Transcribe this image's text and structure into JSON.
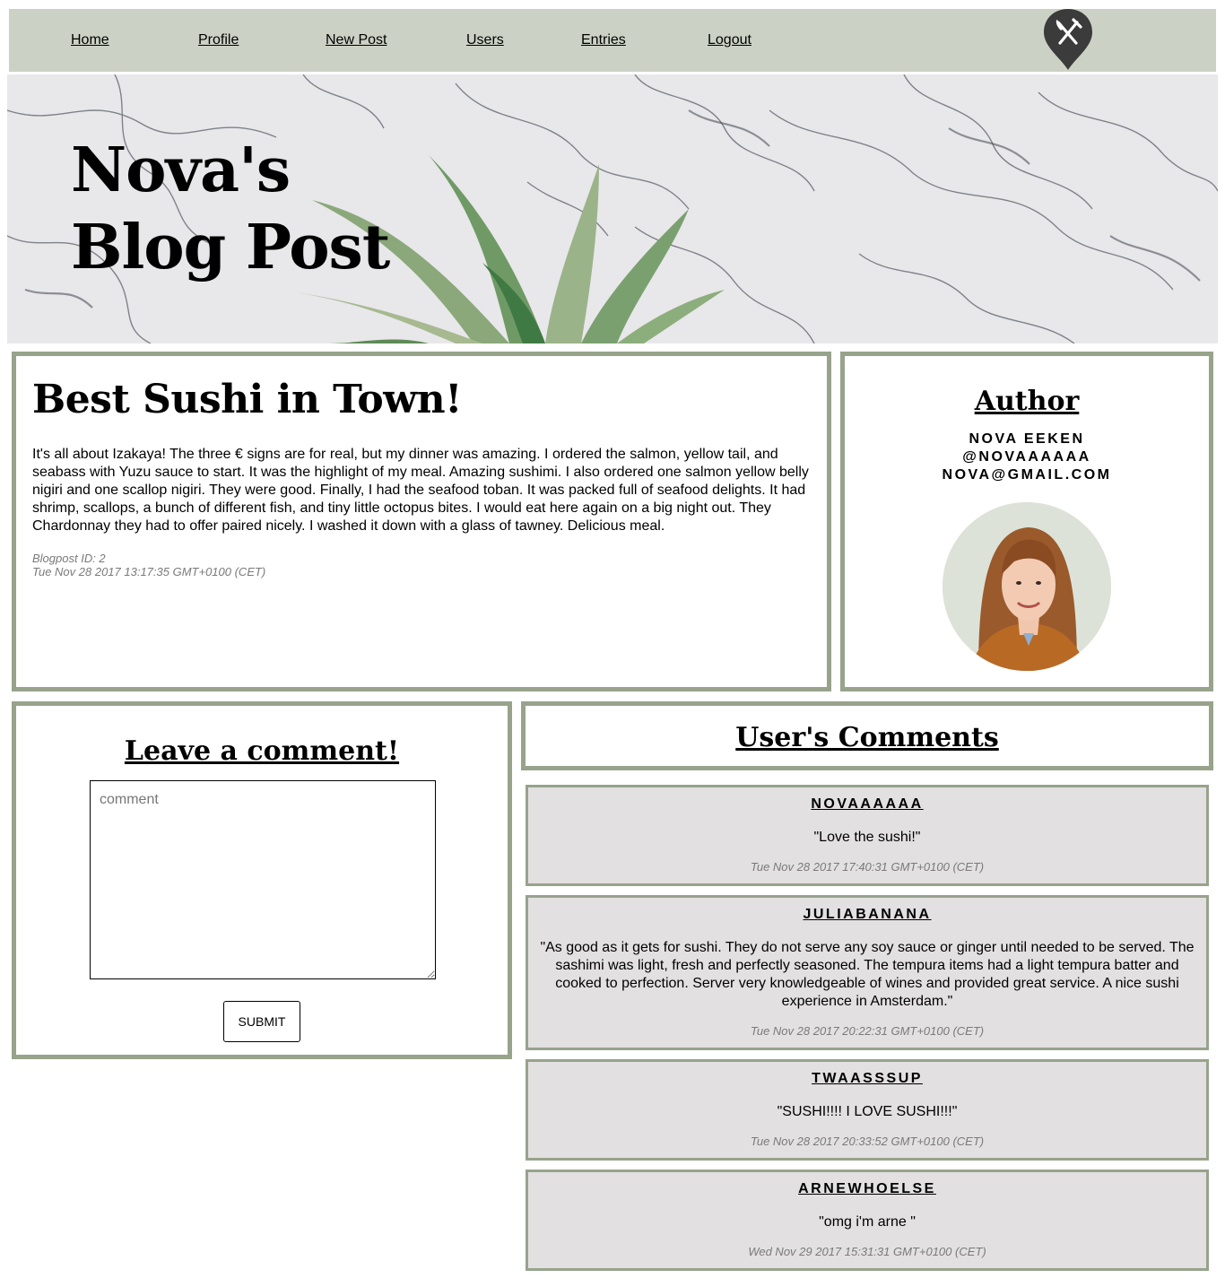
{
  "nav": {
    "items": [
      "Home",
      "Profile",
      "New Post",
      "Users",
      "Entries",
      "Logout"
    ],
    "logo_icon": "fork-knife-pin-icon"
  },
  "hero": {
    "title": "Nova's Blog Post"
  },
  "post": {
    "title": "Best Sushi in Town!",
    "body": "It's all about Izakaya! The three € signs are for real, but my dinner was amazing. I ordered the salmon, yellow tail, and seabass with Yuzu sauce to start. It was the highlight of my meal. Amazing sushimi. I also ordered one salmon yellow belly nigiri and one scallop nigiri. They were good. Finally, I had the seafood toban. It was packed full of seafood delights. It had shrimp, scallops, a bunch of different fish, and tiny little octopus bites. I would eat here again on a big night out. They Chardonnay they had to offer paired nicely. I washed it down with a glass of tawney. Delicious meal.",
    "id_label": "Blogpost ID: 2",
    "date": "Tue Nov 28 2017 13:17:35 GMT+0100 (CET)"
  },
  "author": {
    "heading": "Author",
    "name": "NOVA EEKEN",
    "handle": "@NOVAAAAAA",
    "email": "NOVA@GMAIL.COM"
  },
  "comment_form": {
    "heading": "Leave a comment!",
    "placeholder": "comment",
    "submit_label": "SUBMIT"
  },
  "user_comments": {
    "heading": "User's Comments",
    "items": [
      {
        "user": "NOVAAAAAA",
        "text": "\"Love the sushi!\"",
        "date": "Tue Nov 28 2017 17:40:31 GMT+0100 (CET)"
      },
      {
        "user": "JULIABANANA",
        "text": "\"As good as it gets for sushi. They do not serve any soy sauce or ginger until needed to be served. The sashimi was light, fresh and perfectly seasoned. The tempura items had a light tempura batter and cooked to perfection. Server very knowledgeable of wines and provided great service. A nice sushi experience in Amsterdam.\"",
        "date": "Tue Nov 28 2017 20:22:31 GMT+0100 (CET)"
      },
      {
        "user": "TWAASSSUP",
        "text": "\"SUSHI!!!! I LOVE SUSHI!!!\"",
        "date": "Tue Nov 28 2017 20:33:52 GMT+0100 (CET)"
      },
      {
        "user": "ARNEWHOELSE",
        "text": "\"omg i'm arne \"",
        "date": "Wed Nov 29 2017 15:31:31 GMT+0100 (CET)"
      }
    ]
  },
  "colors": {
    "nav_bg": "#cbd2c5",
    "panel_border": "#97a38b",
    "comment_bg": "#e2e0e1"
  }
}
